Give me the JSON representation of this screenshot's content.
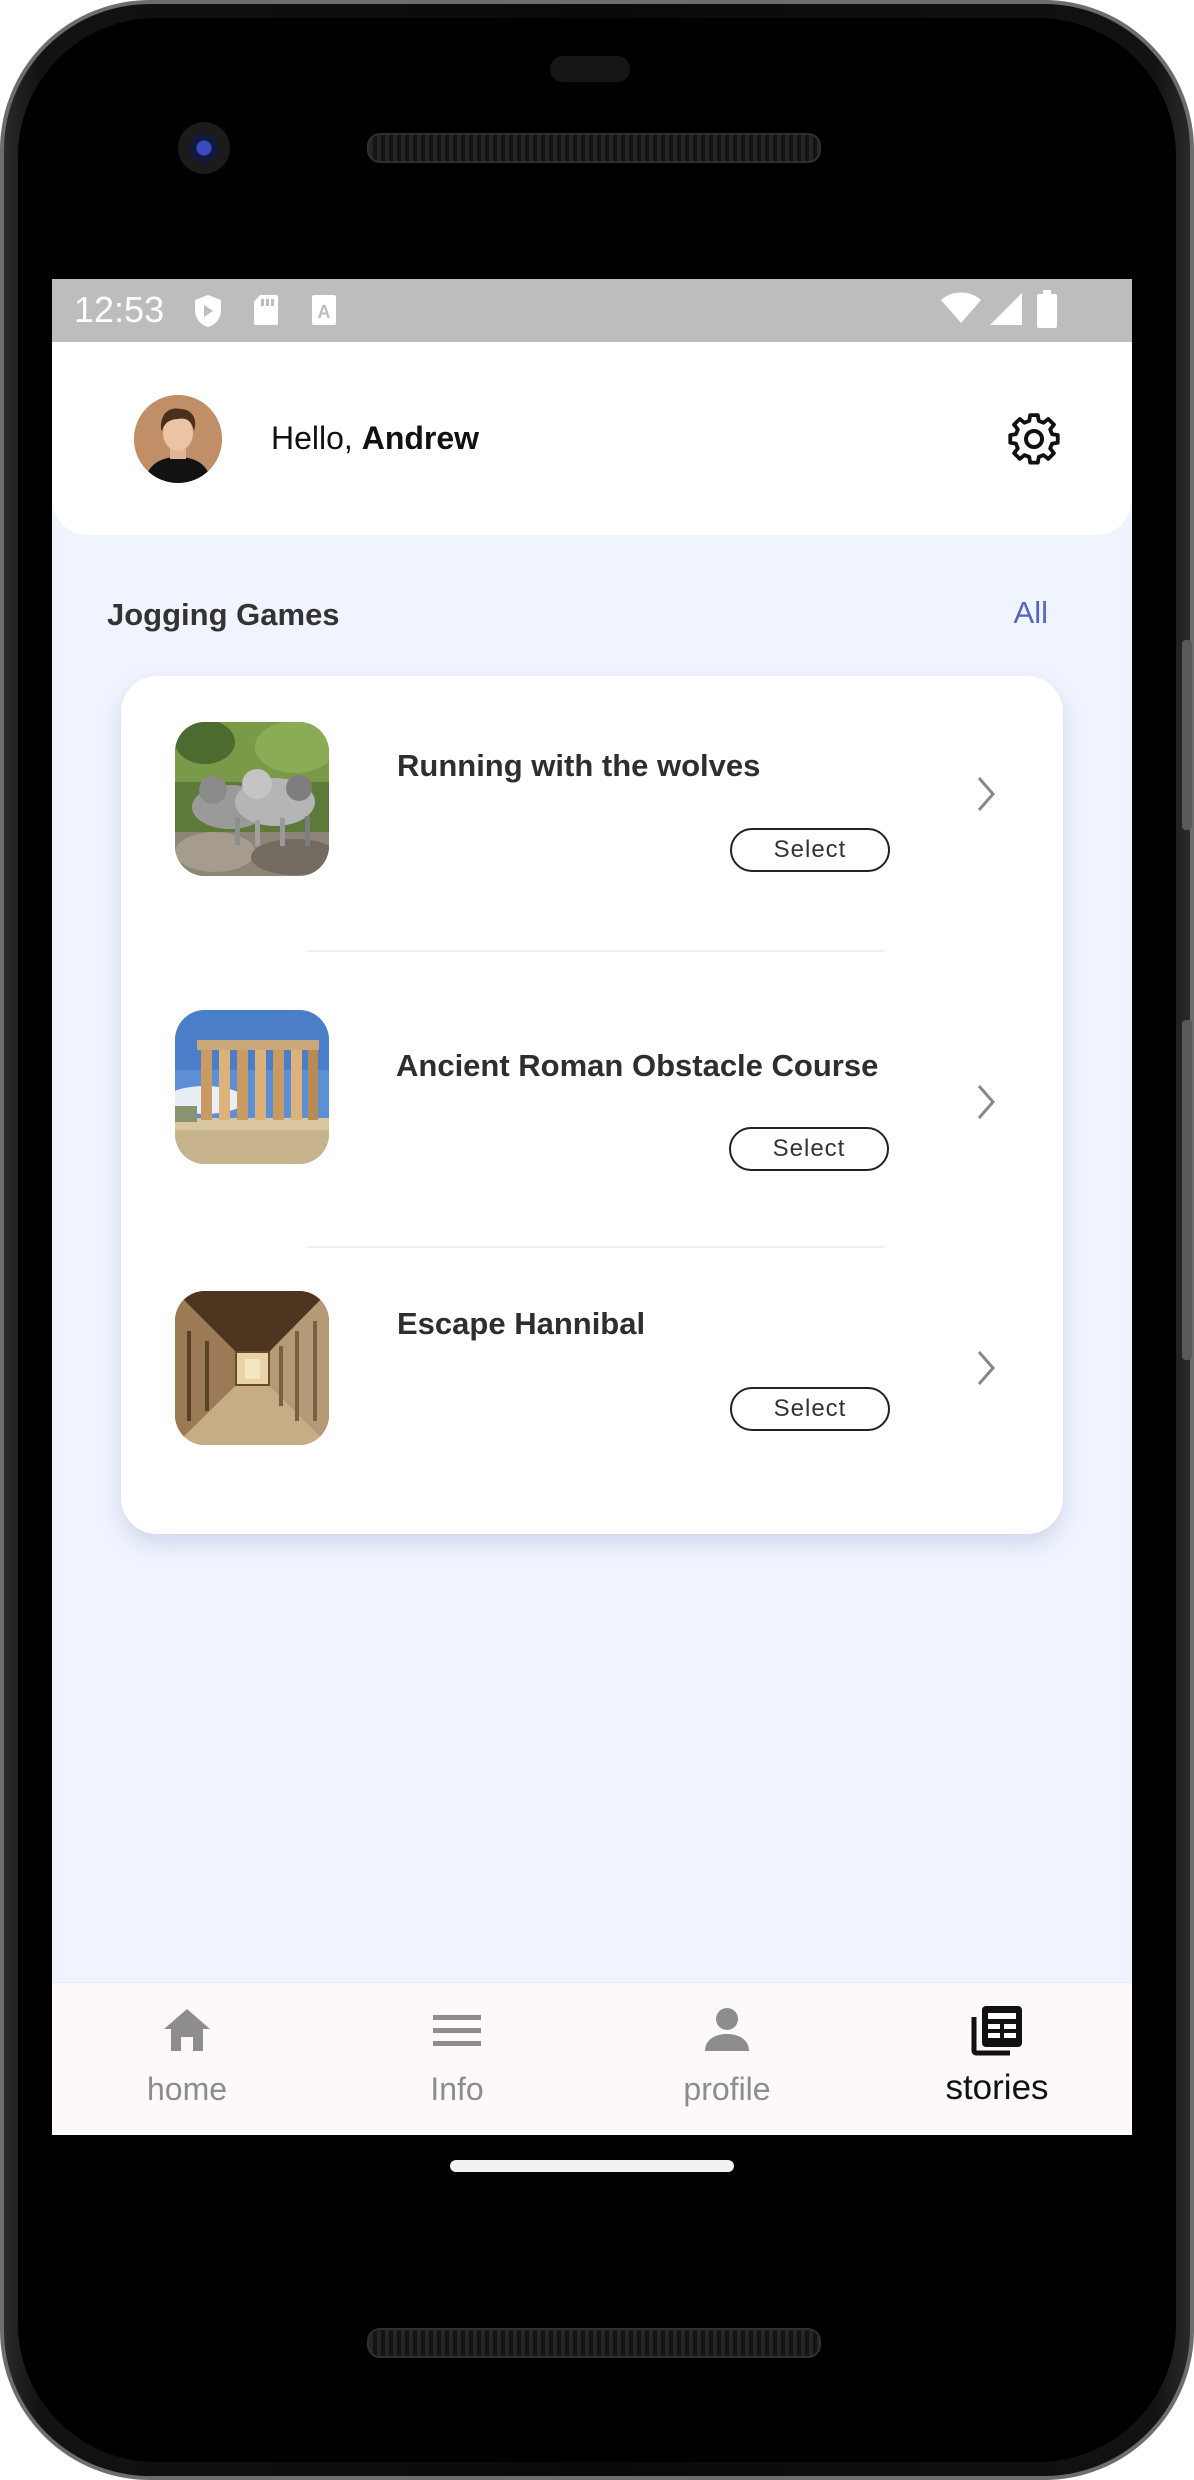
{
  "status_bar": {
    "time": "12:53",
    "left_icons": [
      "shield-icon",
      "sd-card-icon",
      "a-icon"
    ],
    "right_icons": [
      "wifi-icon",
      "signal-icon",
      "battery-icon"
    ]
  },
  "header": {
    "greeting": "Hello,",
    "user_name": "Andrew",
    "avatar_icon": "user-avatar",
    "settings_icon": "gear-icon"
  },
  "section": {
    "title": "Jogging Games",
    "all_link": "All"
  },
  "games": [
    {
      "title": "Running with the wolves",
      "select_label": "Select",
      "image": "wolves-photo"
    },
    {
      "title": "Ancient Roman Obstacle Course",
      "select_label": "Select",
      "image": "temple-columns-photo"
    },
    {
      "title": "Escape Hannibal",
      "select_label": "Select",
      "image": "prison-corridor-photo"
    }
  ],
  "bottom_nav": {
    "items": [
      {
        "label": "home",
        "icon": "home-icon",
        "active": false
      },
      {
        "label": "Info",
        "icon": "menu-icon",
        "active": false
      },
      {
        "label": "profile",
        "icon": "person-icon",
        "active": false
      },
      {
        "label": "stories",
        "icon": "newspaper-icon",
        "active": true
      }
    ]
  },
  "colors": {
    "background": "#f0f4fe",
    "accent": "#5563c4",
    "status_bar": "#bdbdbd",
    "nav_inactive": "#8d8d8d",
    "nav_active": "#111111"
  }
}
